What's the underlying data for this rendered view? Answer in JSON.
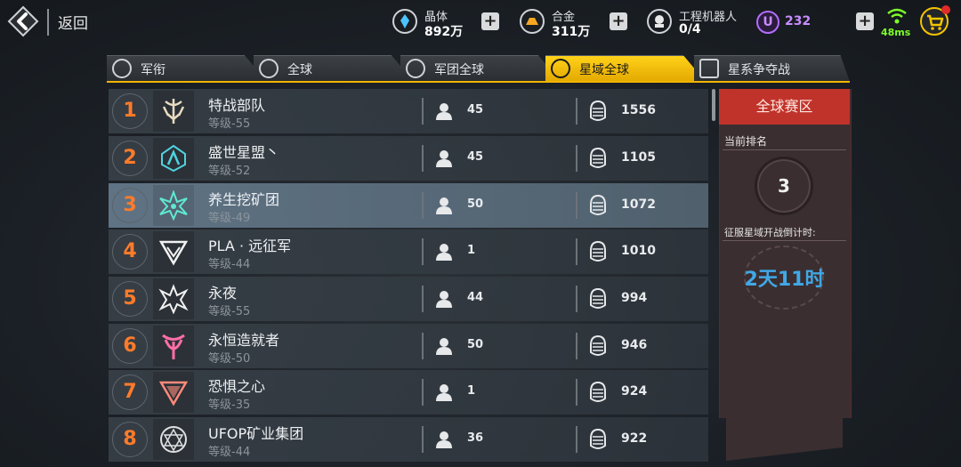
{
  "header": {
    "back_label": "返回"
  },
  "resources": {
    "crystal": {
      "name": "晶体",
      "value": "892万",
      "icon": "crystal-icon"
    },
    "alloy": {
      "name": "合金",
      "value": "311万",
      "icon": "alloy-icon"
    },
    "robot": {
      "name": "工程机器人",
      "value": "0/4",
      "icon": "robot-icon"
    },
    "u_currency": {
      "symbol": "U",
      "value": "232",
      "color": "#c98cff"
    }
  },
  "network": {
    "ping": "48ms",
    "color": "#7dff2a"
  },
  "tabs": [
    {
      "label": "军衔",
      "active": false
    },
    {
      "label": "全球",
      "active": false
    },
    {
      "label": "军团全球",
      "active": false
    },
    {
      "label": "星域全球",
      "active": true
    },
    {
      "label": "星系争夺战",
      "active": false
    }
  ],
  "accent_color": "#f2b500",
  "rows": [
    {
      "rank": "1",
      "name": "特战部队",
      "level": "等级-55",
      "members": "45",
      "score": "1556",
      "emblem_color": "#e8dcc0"
    },
    {
      "rank": "2",
      "name": "盛世星盟丶",
      "level": "等级-52",
      "members": "45",
      "score": "1105",
      "emblem_color": "#4fd3e0"
    },
    {
      "rank": "3",
      "name": "养生挖矿团",
      "level": "等级-49",
      "members": "50",
      "score": "1072",
      "emblem_color": "#5fe8d2",
      "highlight": true
    },
    {
      "rank": "4",
      "name": "PLA · 远征军",
      "level": "等级-44",
      "members": "1",
      "score": "1010",
      "emblem_color": "#f2f2f2"
    },
    {
      "rank": "5",
      "name": "永夜",
      "level": "等级-55",
      "members": "44",
      "score": "994",
      "emblem_color": "#f2f2f2"
    },
    {
      "rank": "6",
      "name": "永恒造就者",
      "level": "等级-50",
      "members": "50",
      "score": "946",
      "emblem_color": "#ff6fa8"
    },
    {
      "rank": "7",
      "name": "恐惧之心",
      "level": "等级-35",
      "members": "1",
      "score": "924",
      "emblem_color": "#ff8a7a"
    },
    {
      "rank": "8",
      "name": "UFOP矿业集团",
      "level": "等级-44",
      "members": "36",
      "score": "922",
      "emblem_color": "#e0e0e0"
    }
  ],
  "side_panel": {
    "title": "全球赛区",
    "rank_label": "当前排名",
    "rank_value": "3",
    "countdown_label": "征服星域开战倒计时:",
    "countdown_value": "2天11时",
    "countdown_color": "#41a8e6"
  }
}
